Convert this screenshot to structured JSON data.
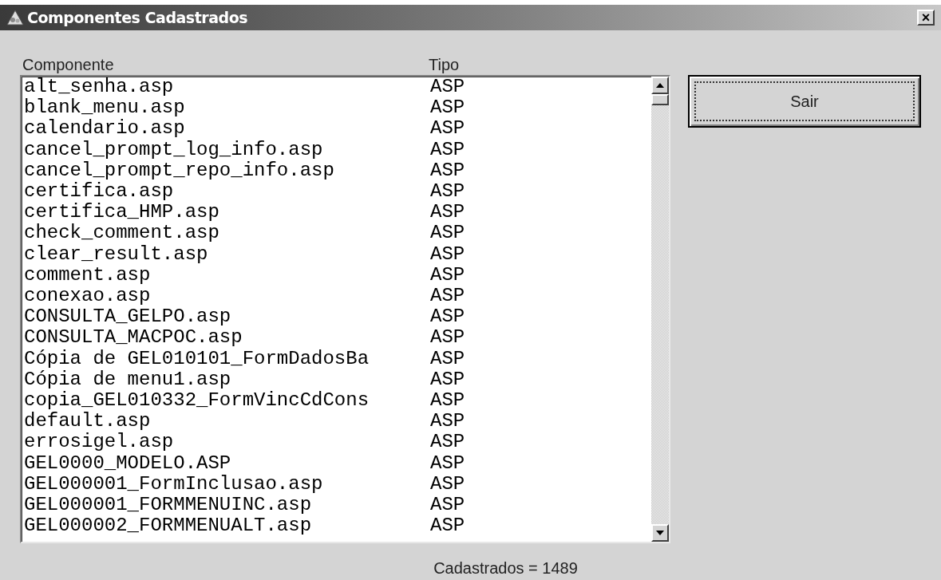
{
  "window": {
    "title": "Componentes Cadastrados",
    "close": "×"
  },
  "columns": [
    "Componente",
    "Tipo"
  ],
  "rows": [
    {
      "name": "alt_senha.asp",
      "type": "ASP"
    },
    {
      "name": "blank_menu.asp",
      "type": "ASP"
    },
    {
      "name": "calendario.asp",
      "type": "ASP"
    },
    {
      "name": "cancel_prompt_log_info.asp",
      "type": "ASP"
    },
    {
      "name": "cancel_prompt_repo_info.asp",
      "type": "ASP"
    },
    {
      "name": "certifica.asp",
      "type": "ASP"
    },
    {
      "name": "certifica_HMP.asp",
      "type": "ASP"
    },
    {
      "name": "check_comment.asp",
      "type": "ASP"
    },
    {
      "name": "clear_result.asp",
      "type": "ASP"
    },
    {
      "name": "comment.asp",
      "type": "ASP"
    },
    {
      "name": "conexao.asp",
      "type": "ASP"
    },
    {
      "name": "CONSULTA_GELPO.asp",
      "type": "ASP"
    },
    {
      "name": "CONSULTA_MACPOC.asp",
      "type": "ASP"
    },
    {
      "name": "Cópia de GEL010101_FormDadosBa",
      "type": "ASP"
    },
    {
      "name": "Cópia de menu1.asp",
      "type": "ASP"
    },
    {
      "name": "copia_GEL010332_FormVincCdCons",
      "type": "ASP"
    },
    {
      "name": "default.asp",
      "type": "ASP"
    },
    {
      "name": "errosigel.asp",
      "type": "ASP"
    },
    {
      "name": "GEL0000_MODELO.ASP",
      "type": "ASP"
    },
    {
      "name": "GEL000001_FormInclusao.asp",
      "type": "ASP"
    },
    {
      "name": "GEL000001_FORMMENUINC.asp",
      "type": "ASP"
    },
    {
      "name": "GEL000002_FORMMENUALT.asp",
      "type": "ASP"
    }
  ],
  "exit_button": "Sair",
  "footer": "Cadastrados = 1489"
}
